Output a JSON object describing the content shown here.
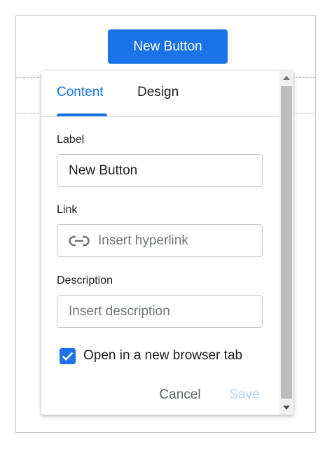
{
  "page_button": {
    "label": "New Button"
  },
  "dialog": {
    "tabs": [
      {
        "label": "Content",
        "active": true
      },
      {
        "label": "Design",
        "active": false
      }
    ],
    "label_field": {
      "label": "Label",
      "value": "New Button"
    },
    "link_field": {
      "label": "Link",
      "placeholder": "Insert hyperlink",
      "icon": "link-icon"
    },
    "description_field": {
      "label": "Description",
      "placeholder": "Insert description"
    },
    "new_tab_checkbox": {
      "label": "Open in a new browser tab",
      "checked": true
    },
    "actions": {
      "cancel": "Cancel",
      "save": "Save"
    }
  },
  "colors": {
    "accent": "#1a73e8",
    "disabled_save": "#b6d2f7",
    "text": "#202124",
    "placeholder": "#70757a"
  }
}
